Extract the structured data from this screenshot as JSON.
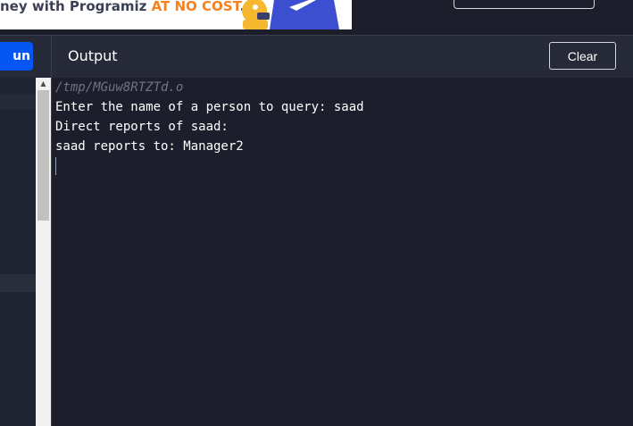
{
  "banner": {
    "text_prefix": "ney with Programiz ",
    "text_accent": "AT NO COST",
    "text_suffix": ".",
    "accent_color": "#f5811f"
  },
  "toolbar": {
    "run_label": "un",
    "output_title": "Output",
    "clear_label": "Clear",
    "run_color": "#0556f3"
  },
  "console": {
    "lines": [
      "/tmp/MGuw8RTZTd.o",
      "Enter the name of a person to query: saad",
      "Direct reports of saad:",
      "saad reports to: Manager2"
    ]
  },
  "theme": {
    "background": "#1c1f2b",
    "header_background": "#262937",
    "scrollbar_arrow_icon": "triangle-up"
  }
}
